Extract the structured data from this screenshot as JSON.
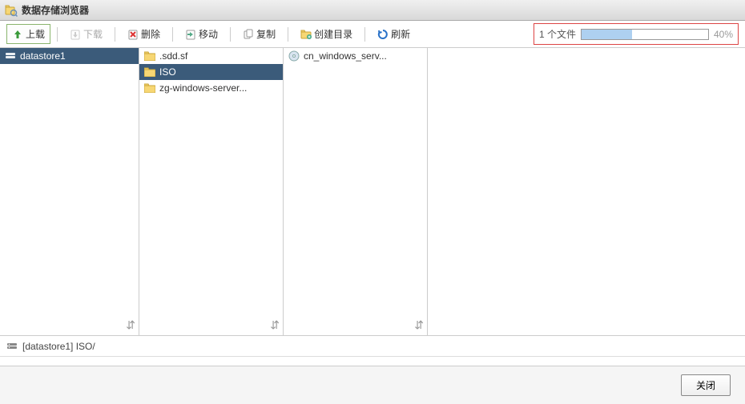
{
  "window": {
    "title": "数据存储浏览器"
  },
  "toolbar": {
    "upload": "上载",
    "download": "下载",
    "delete": "删除",
    "move": "移动",
    "copy": "复制",
    "mkdir": "创建目录",
    "refresh": "刷新"
  },
  "progress": {
    "label": "1 个文件",
    "percent": 40,
    "percent_text": "40%"
  },
  "columns": {
    "col1": [
      {
        "label": "datastore1",
        "selected": true
      }
    ],
    "col2": [
      {
        "label": ".sdd.sf",
        "selected": false
      },
      {
        "label": "ISO",
        "selected": true
      },
      {
        "label": "zg-windows-server...",
        "selected": false
      }
    ],
    "col3": [
      {
        "label": "cn_windows_serv...",
        "selected": false
      }
    ]
  },
  "path": "[datastore1] ISO/",
  "footer": {
    "close": "关闭"
  }
}
